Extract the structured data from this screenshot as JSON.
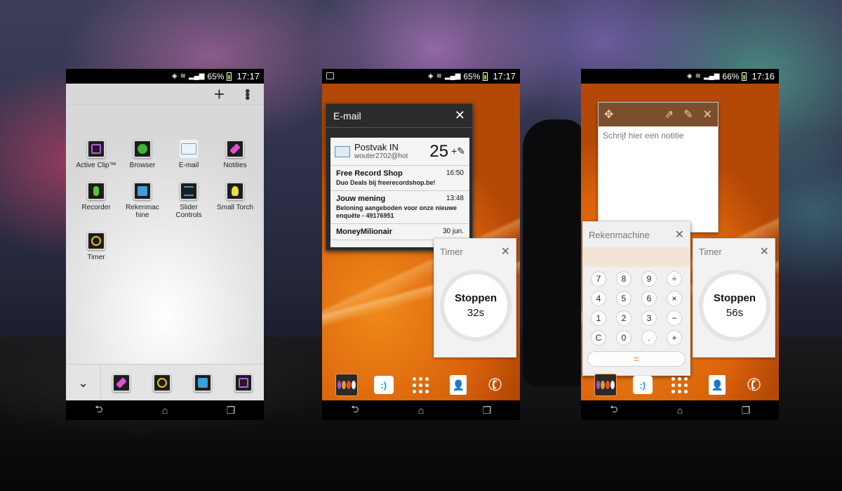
{
  "phone1": {
    "status": {
      "battery": "65%",
      "time": "17:17"
    },
    "topbar": {
      "add": "+",
      "menu": "⋮"
    },
    "apps": [
      {
        "label": "Active Clip™",
        "icon": "active-clip-icon",
        "color": "#b55ce6"
      },
      {
        "label": "Browser",
        "icon": "globe-icon",
        "color": "#3fb43a"
      },
      {
        "label": "E-mail",
        "icon": "envelope-icon",
        "color": "#6aa0d0"
      },
      {
        "label": "Notities",
        "icon": "pencil-icon",
        "color": "#e04fd4"
      },
      {
        "label": "Recorder",
        "icon": "microphone-icon",
        "color": "#5cc43c"
      },
      {
        "label": "Rekenmac hine",
        "icon": "calculator-icon",
        "color": "#3aa0d8"
      },
      {
        "label": "Slider Controls",
        "icon": "sliders-icon",
        "color": "#3a9ad0"
      },
      {
        "label": "Small Torch",
        "icon": "bulb-icon",
        "color": "#e8e040"
      },
      {
        "label": "Timer",
        "icon": "timer-icon",
        "color": "#e8c020"
      }
    ],
    "dock": {
      "collapse": "⌄"
    }
  },
  "phone2": {
    "status": {
      "battery": "65%",
      "time": "17:17"
    },
    "email": {
      "title": "E-mail",
      "close": "✕",
      "inbox": "Postvak IN",
      "account": "wouter2702@hot",
      "count": "25",
      "compose": "+✎",
      "messages": [
        {
          "from": "Free Record Shop",
          "time": "16:50",
          "subject": "Duo Deals bij freerecordshop.be!"
        },
        {
          "from": "Jouw mening",
          "time": "13:48",
          "subject": "Beloning aangeboden voor onze nieuwe enquête - 49176951"
        },
        {
          "from": "MoneyMilionair",
          "time": "30 jun.",
          "subject": ""
        }
      ]
    },
    "timer": {
      "title": "Timer",
      "close": "✕",
      "action": "Stoppen",
      "remaining": "32s"
    }
  },
  "phone3": {
    "status": {
      "battery": "66%",
      "time": "17:16"
    },
    "notes": {
      "move": "✥",
      "share": "⇗",
      "edit": "✎",
      "close": "✕",
      "placeholder": "Schrijf hier een notitie"
    },
    "calculator": {
      "title": "Rekenmachine",
      "close": "✕",
      "keys": [
        "7",
        "8",
        "9",
        "÷",
        "4",
        "5",
        "6",
        "×",
        "1",
        "2",
        "3",
        "−",
        "C",
        "0",
        ".",
        "+"
      ],
      "equals": "="
    },
    "timer": {
      "title": "Timer",
      "close": "✕",
      "action": "Stoppen",
      "remaining": "56s"
    }
  },
  "dock": {
    "messaging": ":)",
    "contacts": "👤"
  },
  "nav": {
    "back": "⮌",
    "home": "⌂",
    "recent": "❐"
  },
  "colors": {
    "accent_orange": "#e07a1d",
    "notes_header": "#7b4f2c"
  }
}
